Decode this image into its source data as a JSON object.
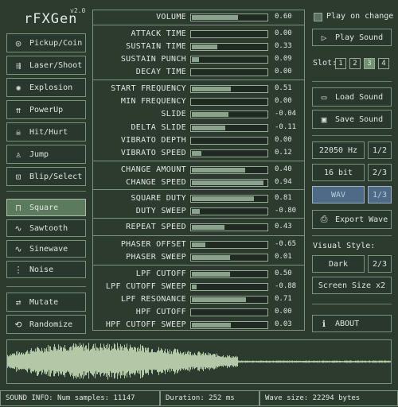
{
  "app": {
    "title": "rFXGen",
    "version": "v2.0"
  },
  "presets": [
    {
      "label": "Pickup/Coin",
      "icon": "coin-icon"
    },
    {
      "label": "Laser/Shoot",
      "icon": "laser-icon"
    },
    {
      "label": "Explosion",
      "icon": "explosion-icon"
    },
    {
      "label": "PowerUp",
      "icon": "powerup-icon"
    },
    {
      "label": "Hit/Hurt",
      "icon": "skull-icon"
    },
    {
      "label": "Jump",
      "icon": "jump-icon"
    },
    {
      "label": "Blip/Select",
      "icon": "blip-icon"
    }
  ],
  "waves": [
    {
      "label": "Square",
      "icon": "square-wave-icon",
      "selected": true
    },
    {
      "label": "Sawtooth",
      "icon": "sawtooth-wave-icon",
      "selected": false
    },
    {
      "label": "Sinewave",
      "icon": "sine-wave-icon",
      "selected": false
    },
    {
      "label": "Noise",
      "icon": "noise-wave-icon",
      "selected": false
    }
  ],
  "actions": {
    "mutate": "Mutate",
    "randomize": "Randomize"
  },
  "params": [
    {
      "label": "VOLUME",
      "value": "0.60",
      "level": 0.6
    },
    {
      "label": "ATTACK TIME",
      "value": "0.00",
      "level": 0.0
    },
    {
      "label": "SUSTAIN TIME",
      "value": "0.33",
      "level": 0.33
    },
    {
      "label": "SUSTAIN PUNCH",
      "value": "0.09",
      "level": 0.09
    },
    {
      "label": "DECAY TIME",
      "value": "0.00",
      "level": 0.0
    },
    {
      "label": "START FREQUENCY",
      "value": "0.51",
      "level": 0.51
    },
    {
      "label": "MIN FREQUENCY",
      "value": "0.00",
      "level": 0.0
    },
    {
      "label": "SLIDE",
      "value": "-0.04",
      "level": 0.48
    },
    {
      "label": "DELTA SLIDE",
      "value": "-0.11",
      "level": 0.44
    },
    {
      "label": "VIBRATO DEPTH",
      "value": "0.00",
      "level": 0.0
    },
    {
      "label": "VIBRATO SPEED",
      "value": "0.12",
      "level": 0.12
    },
    {
      "label": "CHANGE AMOUNT",
      "value": "0.40",
      "level": 0.7
    },
    {
      "label": "CHANGE SPEED",
      "value": "0.94",
      "level": 0.94
    },
    {
      "label": "SQUARE DUTY",
      "value": "0.81",
      "level": 0.81
    },
    {
      "label": "DUTY SWEEP",
      "value": "-0.80",
      "level": 0.1
    },
    {
      "label": "REPEAT SPEED",
      "value": "0.43",
      "level": 0.43
    },
    {
      "label": "PHASER OFFSET",
      "value": "-0.65",
      "level": 0.18
    },
    {
      "label": "PHASER SWEEP",
      "value": "0.01",
      "level": 0.5
    },
    {
      "label": "LPF CUTOFF",
      "value": "0.50",
      "level": 0.5
    },
    {
      "label": "LPF CUTOFF SWEEP",
      "value": "-0.88",
      "level": 0.06
    },
    {
      "label": "LPF RESONANCE",
      "value": "0.71",
      "level": 0.71
    },
    {
      "label": "HPF CUTOFF",
      "value": "0.00",
      "level": 0.0
    },
    {
      "label": "HPF CUTOFF SWEEP",
      "value": "0.03",
      "level": 0.51
    }
  ],
  "right": {
    "play_on_change": "Play on change",
    "play_sound": "Play Sound",
    "slot_label": "Slot:",
    "slots": [
      "1",
      "2",
      "3",
      "4"
    ],
    "selected_slot": "3",
    "load_sound": "Load Sound",
    "save_sound": "Save Sound",
    "sample_rate": "22050 Hz",
    "sample_rate_page": "1/2",
    "bit_depth": "16 bit",
    "bit_depth_page": "2/3",
    "format": "WAV",
    "format_page": "1/3",
    "export_wave": "Export Wave",
    "visual_style_label": "Visual Style:",
    "style": "Dark",
    "style_page": "2/3",
    "screen_size": "Screen Size x2",
    "about": "ABOUT"
  },
  "status": {
    "sound_info": "SOUND INFO: Num samples: 11147",
    "duration": "Duration: 252 ms",
    "wave_size": "Wave size: 22294 bytes"
  },
  "colors": {
    "background": "#2d3b2f",
    "accent": "#8ba38d",
    "selected": "#5c7a5e",
    "waveform": "#b4c8a8"
  }
}
